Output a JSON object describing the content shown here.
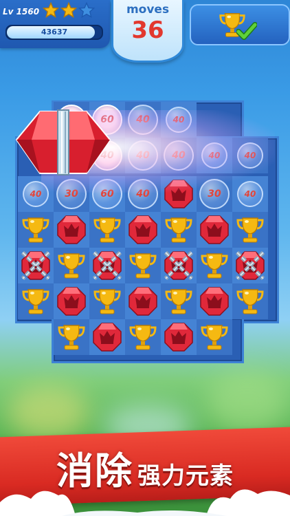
{
  "hud": {
    "level": "Lv 1560",
    "stars_earned": 2,
    "stars_total": 3,
    "score": "43637",
    "score_progress": 0.93,
    "moves_label": "moves",
    "moves_value": "36",
    "goal_icon": "trophy-icon",
    "goal_status_icon": "checkmark-icon"
  },
  "board": {
    "rows": [
      [
        null,
        {
          "bubble": "60",
          "hot": true
        },
        {
          "bubble": "60",
          "hot": true
        },
        {
          "bubble": "40"
        },
        {
          "bubble": "40",
          "small": true
        },
        null,
        null
      ],
      [
        null,
        {
          "bubble": "40",
          "hot": true
        },
        {
          "bubble": "40",
          "hot": true
        },
        {
          "bubble": "40"
        },
        {
          "bubble": "40"
        },
        {
          "bubble": "40",
          "small": true
        },
        {
          "bubble": "40",
          "small": true
        }
      ],
      [
        {
          "bubble": "40",
          "small": true
        },
        {
          "bubble": "30"
        },
        {
          "bubble": "60"
        },
        {
          "bubble": "40"
        },
        {
          "piece": "ruby"
        },
        {
          "bubble": "30"
        },
        {
          "bubble": "40",
          "small": true
        }
      ],
      [
        {
          "piece": "trophy"
        },
        {
          "piece": "ruby"
        },
        {
          "piece": "trophy"
        },
        {
          "piece": "ruby"
        },
        {
          "piece": "trophy"
        },
        {
          "piece": "ruby"
        },
        {
          "piece": "trophy"
        }
      ],
      [
        {
          "piece": "chained-ruby"
        },
        {
          "piece": "trophy"
        },
        {
          "piece": "chained-ruby"
        },
        {
          "piece": "trophy"
        },
        {
          "piece": "chained-ruby"
        },
        {
          "piece": "trophy"
        },
        {
          "piece": "chained-ruby"
        }
      ],
      [
        {
          "piece": "trophy"
        },
        {
          "piece": "ruby"
        },
        {
          "piece": "trophy"
        },
        {
          "piece": "ruby"
        },
        {
          "piece": "trophy"
        },
        {
          "piece": "ruby"
        },
        {
          "piece": "trophy"
        }
      ],
      [
        null,
        {
          "piece": "trophy"
        },
        {
          "piece": "ruby"
        },
        {
          "piece": "trophy"
        },
        {
          "piece": "ruby"
        },
        {
          "piece": "trophy"
        },
        null
      ]
    ],
    "special_piece": "giant-ruby-gem"
  },
  "banner": {
    "big_text": "消除",
    "small_text": "强力元素"
  },
  "colors": {
    "ribbon": "#d92a22",
    "moves_value": "#e2382e",
    "bubble_number": "#e2453a",
    "gold": "#f5b912",
    "ruby": "#e0283a"
  }
}
